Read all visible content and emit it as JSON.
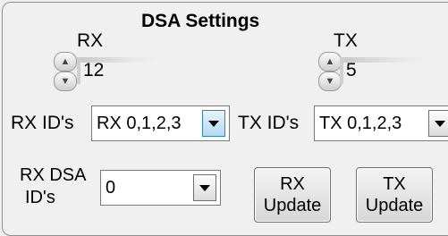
{
  "panel": {
    "title": "DSA Settings"
  },
  "rx": {
    "label": "RX",
    "value": "12",
    "id_label": "RX ID's",
    "id_value": "RX 0,1,2,3",
    "dsa_label_line1": "RX DSA",
    "dsa_label_line2": "ID's",
    "dsa_value": "0",
    "update_line1": "RX",
    "update_line2": "Update"
  },
  "tx": {
    "label": "TX",
    "value": "5",
    "id_label": "TX ID's",
    "id_value": "TX 0,1,2,3",
    "update_line1": "TX",
    "update_line2": "Update"
  }
}
